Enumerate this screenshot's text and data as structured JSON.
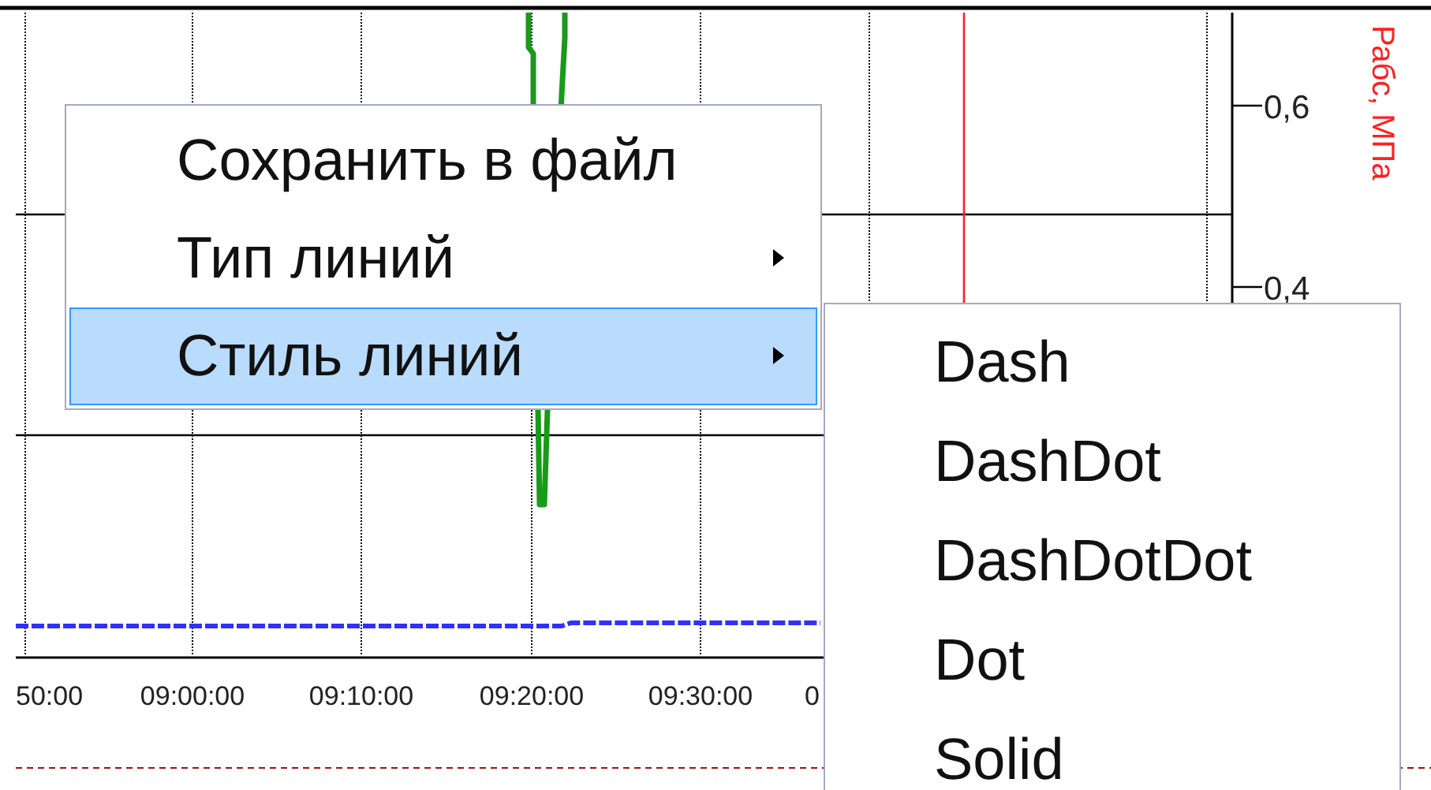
{
  "chart": {
    "y_axis_label": "Рабс, МПа",
    "y_ticks": [
      "0,6",
      "0,4"
    ],
    "x_ticks": [
      "50:00",
      "09:00:00",
      "09:10:00",
      "09:20:00",
      "09:30:00",
      "0"
    ]
  },
  "context_menu": {
    "items": [
      {
        "label": "Сохранить в файл",
        "has_submenu": false,
        "selected": false
      },
      {
        "label": "Тип линий",
        "has_submenu": true,
        "selected": false
      },
      {
        "label": "Стиль линий",
        "has_submenu": true,
        "selected": true
      }
    ]
  },
  "submenu": {
    "items": [
      {
        "label": "Dash",
        "selected": false
      },
      {
        "label": "DashDot",
        "selected": false
      },
      {
        "label": "DashDotDot",
        "selected": false
      },
      {
        "label": "Dot",
        "selected": false
      },
      {
        "label": "Solid",
        "selected": false
      }
    ]
  }
}
